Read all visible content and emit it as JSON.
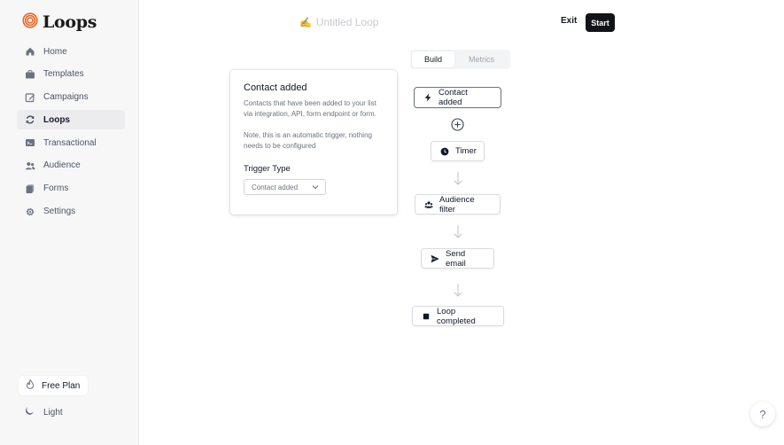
{
  "sidebar": {
    "logo": "Loops",
    "items": [
      {
        "label": "Home",
        "icon": "home-icon"
      },
      {
        "label": "Templates",
        "icon": "briefcase-icon"
      },
      {
        "label": "Campaigns",
        "icon": "edit-icon"
      },
      {
        "label": "Loops",
        "icon": "refresh-icon",
        "active": true
      },
      {
        "label": "Transactional",
        "icon": "terminal-icon"
      },
      {
        "label": "Audience",
        "icon": "users-icon"
      },
      {
        "label": "Forms",
        "icon": "document-icon"
      },
      {
        "label": "Settings",
        "icon": "gear-icon"
      }
    ],
    "plan": "Free Plan",
    "theme": "Light"
  },
  "header": {
    "title_emoji": "✍️",
    "title": "Untitled Loop",
    "exit": "Exit",
    "start": "Start"
  },
  "tabs": [
    "Build",
    "Metrics"
  ],
  "panel": {
    "title": "Contact added",
    "description": "Contacts that have been added to your list via integration, API, form endpoint or form.",
    "note": "Note, this is an automatic trigger, nothing needs to be configured",
    "trigger_label": "Trigger Type",
    "trigger_value": "Contact added"
  },
  "flow": [
    {
      "label": "Contact added",
      "icon": "lightning-icon"
    },
    {
      "label": "Timer",
      "icon": "clock-icon"
    },
    {
      "label": "Audience filter",
      "icon": "users-icon"
    },
    {
      "label": "Send email",
      "icon": "send-icon"
    },
    {
      "label": "Loop completed",
      "icon": "stop-icon"
    }
  ],
  "help": "?",
  "colors": {
    "accent": "#e8661d",
    "button": "#111318"
  }
}
